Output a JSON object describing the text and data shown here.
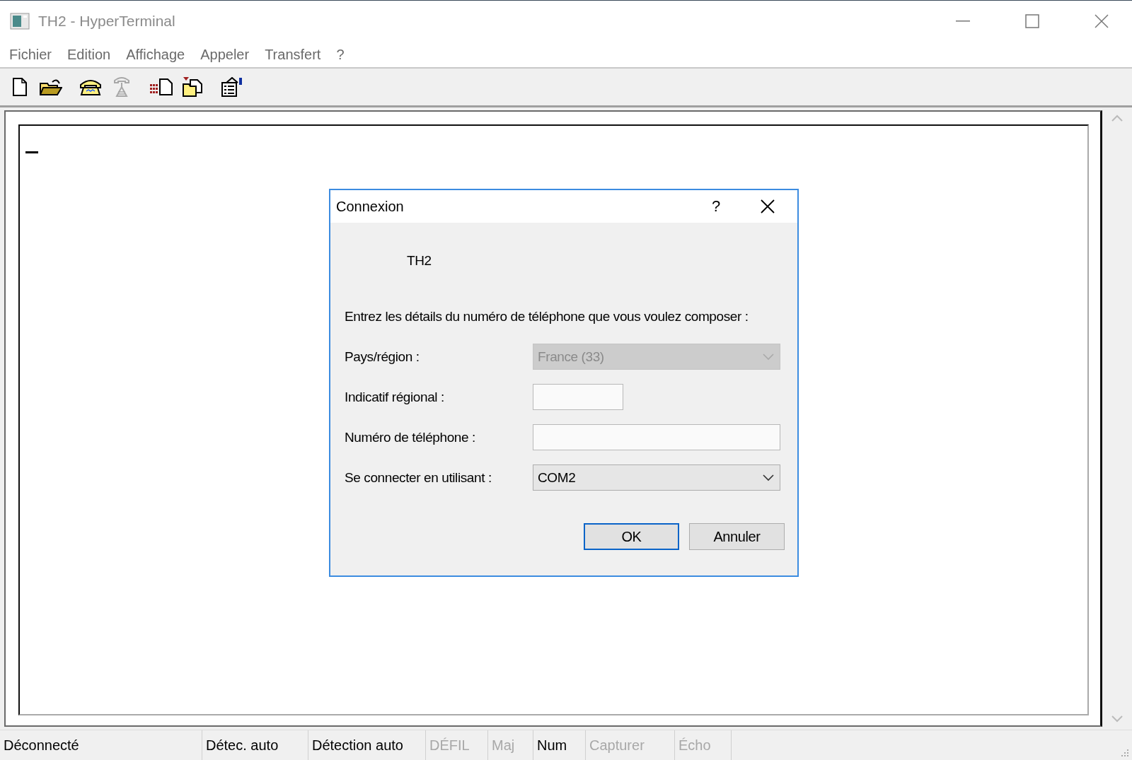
{
  "window": {
    "title": "TH2 - HyperTerminal"
  },
  "menu": [
    "Fichier",
    "Edition",
    "Affichage",
    "Appeler",
    "Transfert",
    "?"
  ],
  "toolbar": [
    {
      "kind": "new",
      "disabled": false
    },
    {
      "kind": "open",
      "disabled": false
    },
    {
      "kind": "call",
      "disabled": false
    },
    {
      "kind": "hangup",
      "disabled": true
    },
    {
      "kind": "send",
      "disabled": false
    },
    {
      "kind": "receive",
      "disabled": false
    },
    {
      "kind": "properties",
      "disabled": false
    }
  ],
  "dialog": {
    "title": "Connexion",
    "help": "?",
    "name": "TH2",
    "instruction": "Entrez les détails du numéro de téléphone que vous voulez composer :",
    "fields": [
      {
        "kind": "combo",
        "label": "Pays/région :",
        "value": "France (33)",
        "disabled": true,
        "wide": true
      },
      {
        "kind": "text",
        "label": "Indicatif régional :",
        "disabled": false,
        "wide": false
      },
      {
        "kind": "text",
        "label": "Numéro de téléphone :",
        "disabled": false,
        "wide": true
      },
      {
        "kind": "combo",
        "label": "Se connecter en utilisant :",
        "value": "COM2",
        "disabled": false,
        "wide": true
      }
    ],
    "buttons": [
      {
        "label": "OK",
        "default": true
      },
      {
        "label": "Annuler",
        "default": false
      }
    ]
  },
  "status_bar": [
    {
      "text": "Déconnecté",
      "disabled": false
    },
    {
      "text": "Détec. auto",
      "disabled": false
    },
    {
      "text": "Détection auto",
      "disabled": false
    },
    {
      "text": "DÉFIL",
      "disabled": true
    },
    {
      "text": "Maj",
      "disabled": true
    },
    {
      "text": "Num",
      "disabled": false
    },
    {
      "text": "Capturer",
      "disabled": true
    },
    {
      "text": "Écho",
      "disabled": true
    }
  ]
}
